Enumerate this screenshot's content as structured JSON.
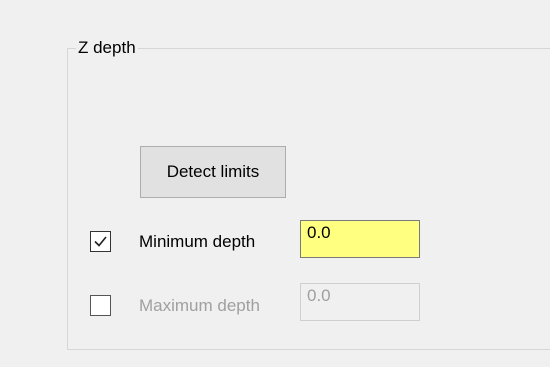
{
  "group": {
    "title": "Z depth"
  },
  "detect_button": {
    "label": "Detect limits"
  },
  "minimum_depth": {
    "label": "Minimum depth",
    "checked": true,
    "value": "0.0",
    "enabled": true,
    "field_color": "#ffff80"
  },
  "maximum_depth": {
    "label": "Maximum depth",
    "checked": false,
    "value": "0.0",
    "enabled": false
  }
}
